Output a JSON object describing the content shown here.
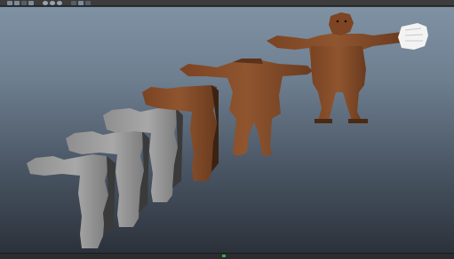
{
  "toolbar": {
    "icons": [
      "select-tool-icon",
      "move-tool-icon",
      "rotate-tool-icon",
      "scale-tool-icon",
      "snap-grid-icon",
      "snap-curve-icon",
      "snap-point-icon",
      "render-icon",
      "ipr-render-icon",
      "render-settings-icon"
    ]
  },
  "viewport": {
    "colors": {
      "gradient_top": "#7f92a3",
      "gradient_bottom": "#2b313a",
      "skin": "#8a4f2a",
      "skin_shadow": "#5c321a",
      "gray_model": "#9a9a9a",
      "glove": "#f2f2f2"
    }
  },
  "status": {
    "indicator_color": "#3ea84a"
  }
}
